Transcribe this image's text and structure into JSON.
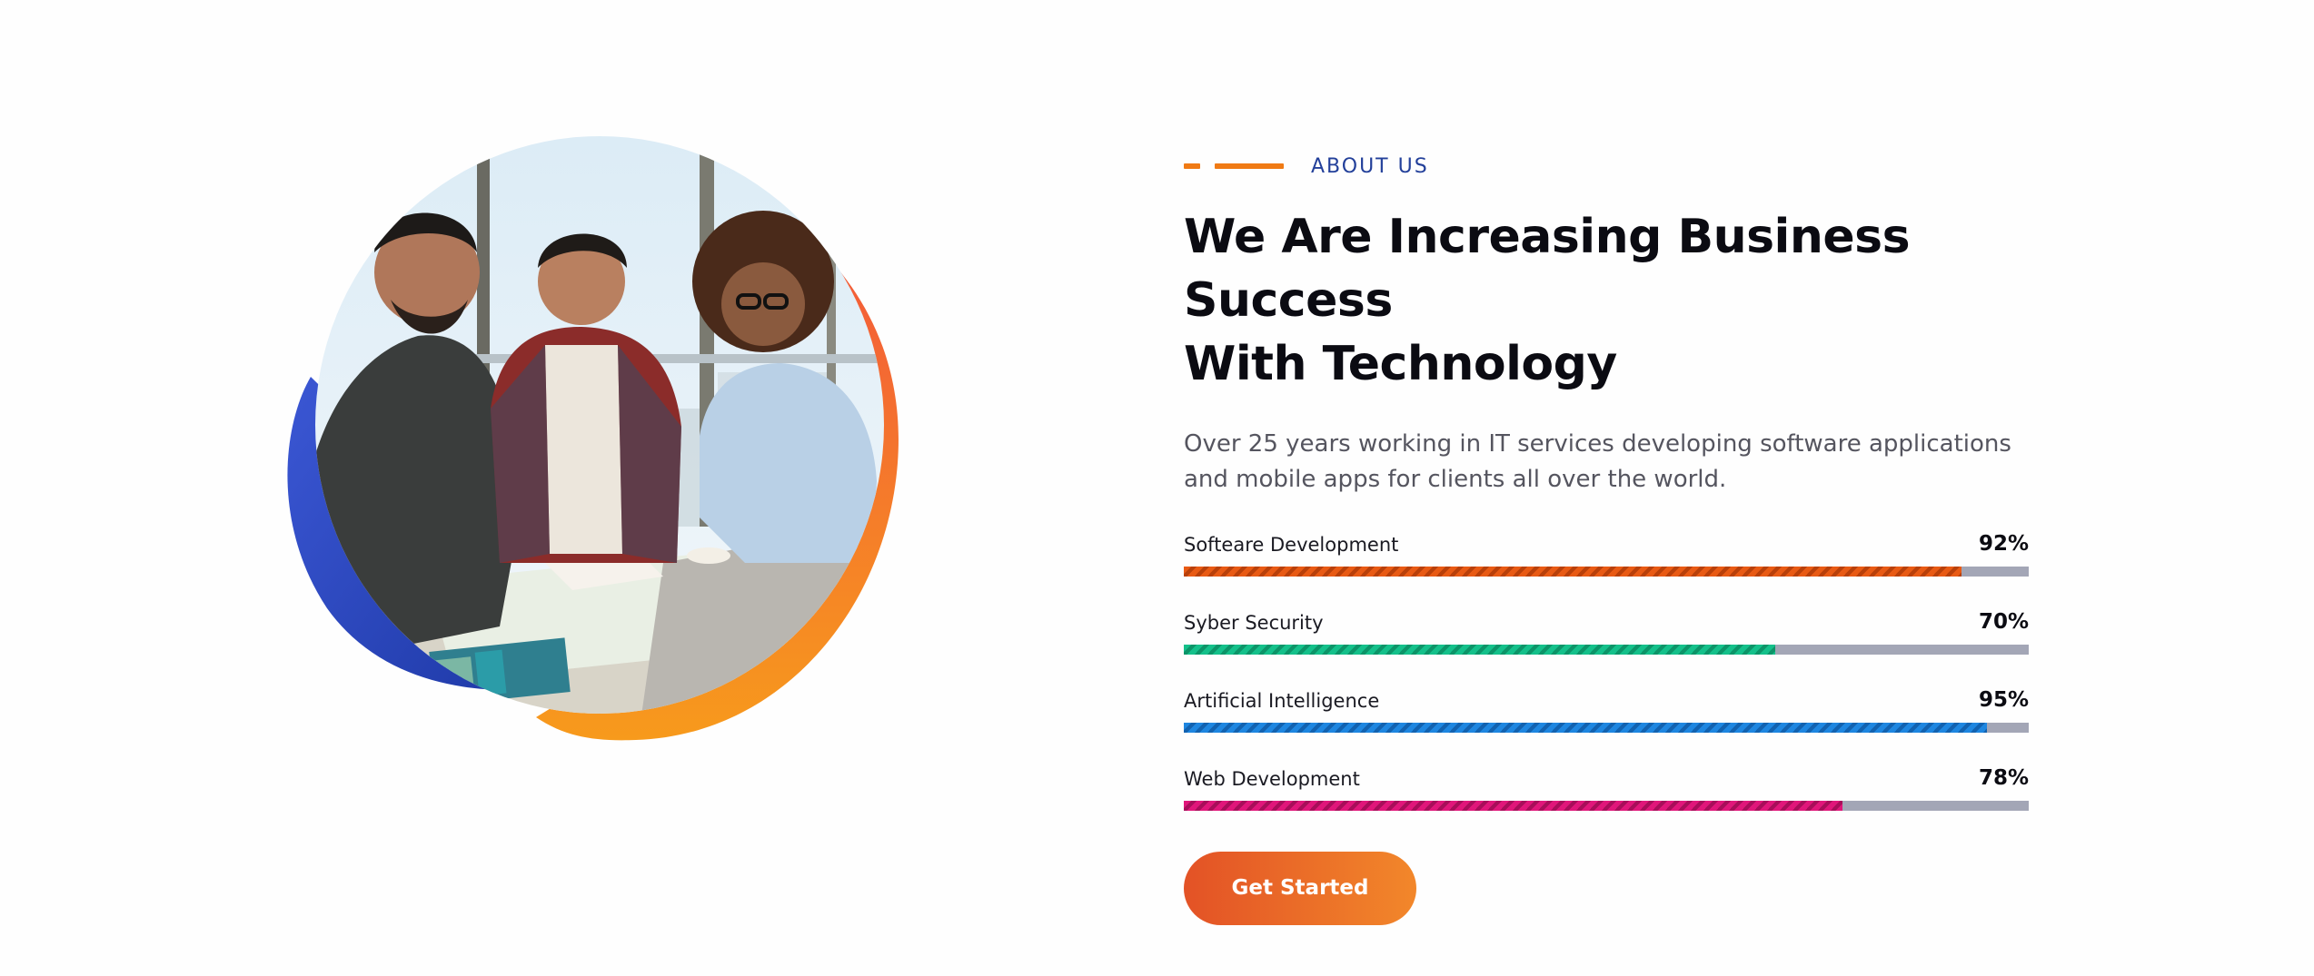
{
  "about": {
    "eyebrow": "ABOUT US",
    "heading_line1": "We Are Increasing Business Success",
    "heading_line2": "With Technology",
    "description": "Over 25 years working in IT services developing software applications and mobile apps for clients all over the world."
  },
  "skills": [
    {
      "name": "Softeare Development",
      "percent_label": "92%",
      "value": 92,
      "color": "#e85a14",
      "stripe": "#b8400a"
    },
    {
      "name": "Syber Security",
      "percent_label": "70%",
      "value": 70,
      "color": "#14c08a",
      "stripe": "#0c9468"
    },
    {
      "name": "Artificial Intelligence",
      "percent_label": "95%",
      "value": 95,
      "color": "#1e86e0",
      "stripe": "#1262b0"
    },
    {
      "name": "Web Development",
      "percent_label": "78%",
      "value": 78,
      "color": "#e0167a",
      "stripe": "#a80e5a"
    }
  ],
  "cta": {
    "label": "Get Started"
  },
  "colors": {
    "accent_orange": "#f07a14",
    "accent_blue": "#23409a",
    "blob_blue": "#2a4cc8",
    "blob_red": "#f25a3c",
    "blob_orange": "#f6921e"
  }
}
